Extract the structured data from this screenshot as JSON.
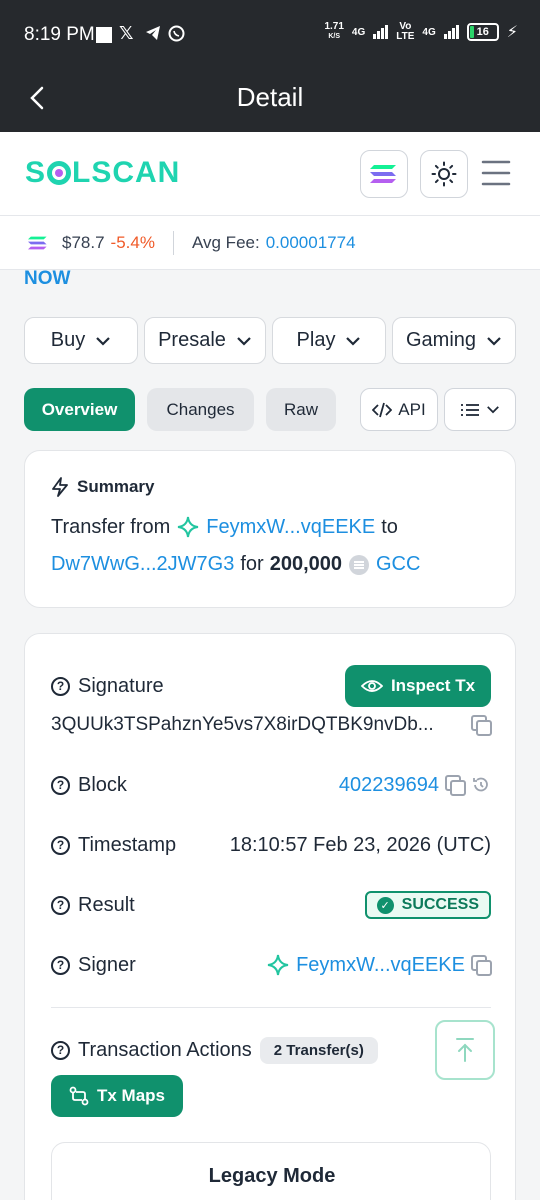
{
  "status_bar": {
    "time": "8:19 PM",
    "speed_value": "1.71",
    "speed_unit": "K/S",
    "net1": "4G",
    "volte_top": "Vo",
    "volte_bottom": "LTE",
    "net2": "4G",
    "battery": "16"
  },
  "app_bar": {
    "title": "Detail"
  },
  "site": {
    "logo": "SOLSCAN"
  },
  "price_bar": {
    "price": "$78.7",
    "change": "-5.4%",
    "fee_label": "Avg Fee:",
    "fee_value": "0.00001774"
  },
  "banner": {
    "now": "NOW"
  },
  "dropdowns": [
    "Buy",
    "Presale",
    "Play",
    "Gaming"
  ],
  "tabs": {
    "overview": "Overview",
    "changes": "Changes",
    "raw": "Raw",
    "api": "API"
  },
  "summary": {
    "title": "Summary",
    "transfer_from": "Transfer from",
    "from_addr": "FeymxW...vqEEKE",
    "to": "to",
    "to_addr": "Dw7WwG...2JW7G3",
    "for": "for",
    "amount": "200,000",
    "token": "GCC"
  },
  "details": {
    "signature_label": "Signature",
    "inspect_button": "Inspect Tx",
    "signature_value": "3QUUk3TSPahznYe5vs7X8irDQTBK9nvDb...",
    "block_label": "Block",
    "block_value": "402239694",
    "timestamp_label": "Timestamp",
    "timestamp_value": "18:10:57 Feb 23, 2026 (UTC)",
    "result_label": "Result",
    "result_value": "SUCCESS",
    "signer_label": "Signer",
    "signer_value": "FeymxW...vqEEKE",
    "actions_label": "Transaction Actions",
    "transfers_badge": "2 Transfer(s)",
    "txmaps_button": "Tx Maps",
    "legacy_title": "Legacy Mode"
  },
  "colors": {
    "accent_green": "#10916d",
    "link_blue": "#1d8fe0",
    "negative_orange": "#f05a28",
    "logo_teal": "#1fd4b0",
    "header_dark": "#26292d"
  }
}
